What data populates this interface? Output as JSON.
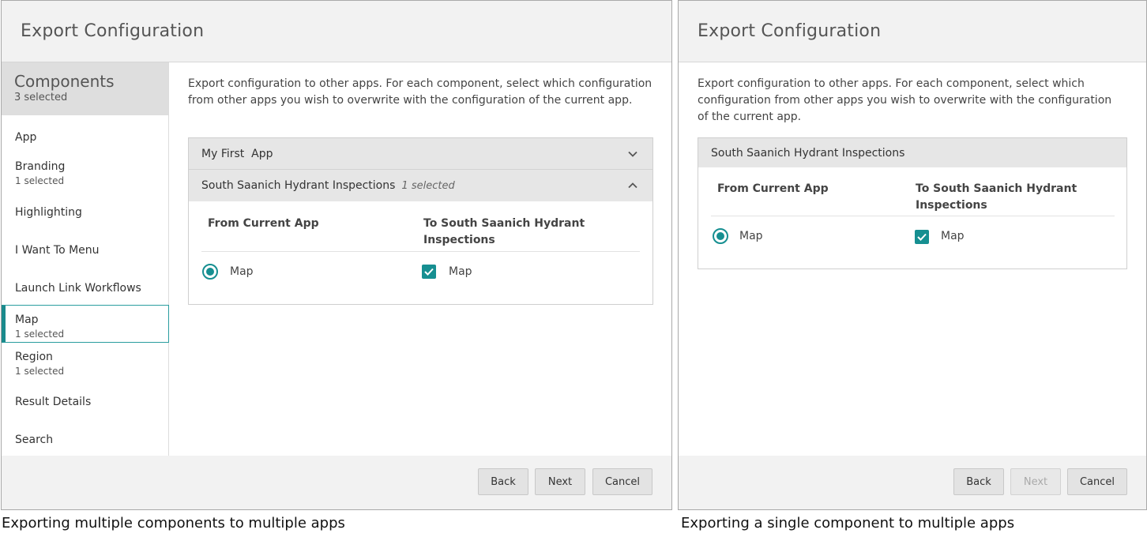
{
  "left": {
    "title": "Export Configuration",
    "sidebar": {
      "heading": "Components",
      "count": "3 selected",
      "items": [
        {
          "label": "App",
          "sub": ""
        },
        {
          "label": "Branding",
          "sub": "1 selected"
        },
        {
          "label": "Highlighting",
          "sub": ""
        },
        {
          "label": "I Want To Menu",
          "sub": ""
        },
        {
          "label": "Launch Link Workflows",
          "sub": ""
        },
        {
          "label": "Map",
          "sub": "1 selected"
        },
        {
          "label": "Region",
          "sub": "1 selected"
        },
        {
          "label": "Result Details",
          "sub": ""
        },
        {
          "label": "Search",
          "sub": ""
        }
      ]
    },
    "intro": "Export configuration to other apps. For each component, select which configuration from other apps you wish to overwrite with the configuration of the current app.",
    "accordion": {
      "section1": "My First  App",
      "section2": "South Saanich Hydrant Inspections",
      "section2_selected": "1 selected",
      "from_header": "From Current App",
      "to_header": "To South Saanich Hydrant Inspections",
      "from_option": "Map",
      "to_option": "Map"
    },
    "buttons": {
      "back": "Back",
      "next": "Next",
      "cancel": "Cancel"
    },
    "caption": "Exporting multiple components to multiple apps"
  },
  "right": {
    "title": "Export Configuration",
    "intro": "Export configuration to other apps. For each component, select which configuration from other apps you wish to overwrite with the configuration of the current app.",
    "panel": {
      "heading": "South Saanich Hydrant Inspections",
      "from_header": "From Current App",
      "to_header": "To South Saanich Hydrant Inspections",
      "from_option": "Map",
      "to_option": "Map"
    },
    "buttons": {
      "back": "Back",
      "next": "Next",
      "cancel": "Cancel"
    },
    "caption": "Exporting a single component to multiple apps"
  },
  "colors": {
    "accent": "#168f91",
    "header_bg": "#f2f2f2",
    "sidebar_head_bg": "#dedede"
  },
  "icons": {
    "expand": "chevron-down-icon",
    "collapse": "chevron-up-icon",
    "radio": "radio-selected",
    "check": "checkbox-checked"
  }
}
